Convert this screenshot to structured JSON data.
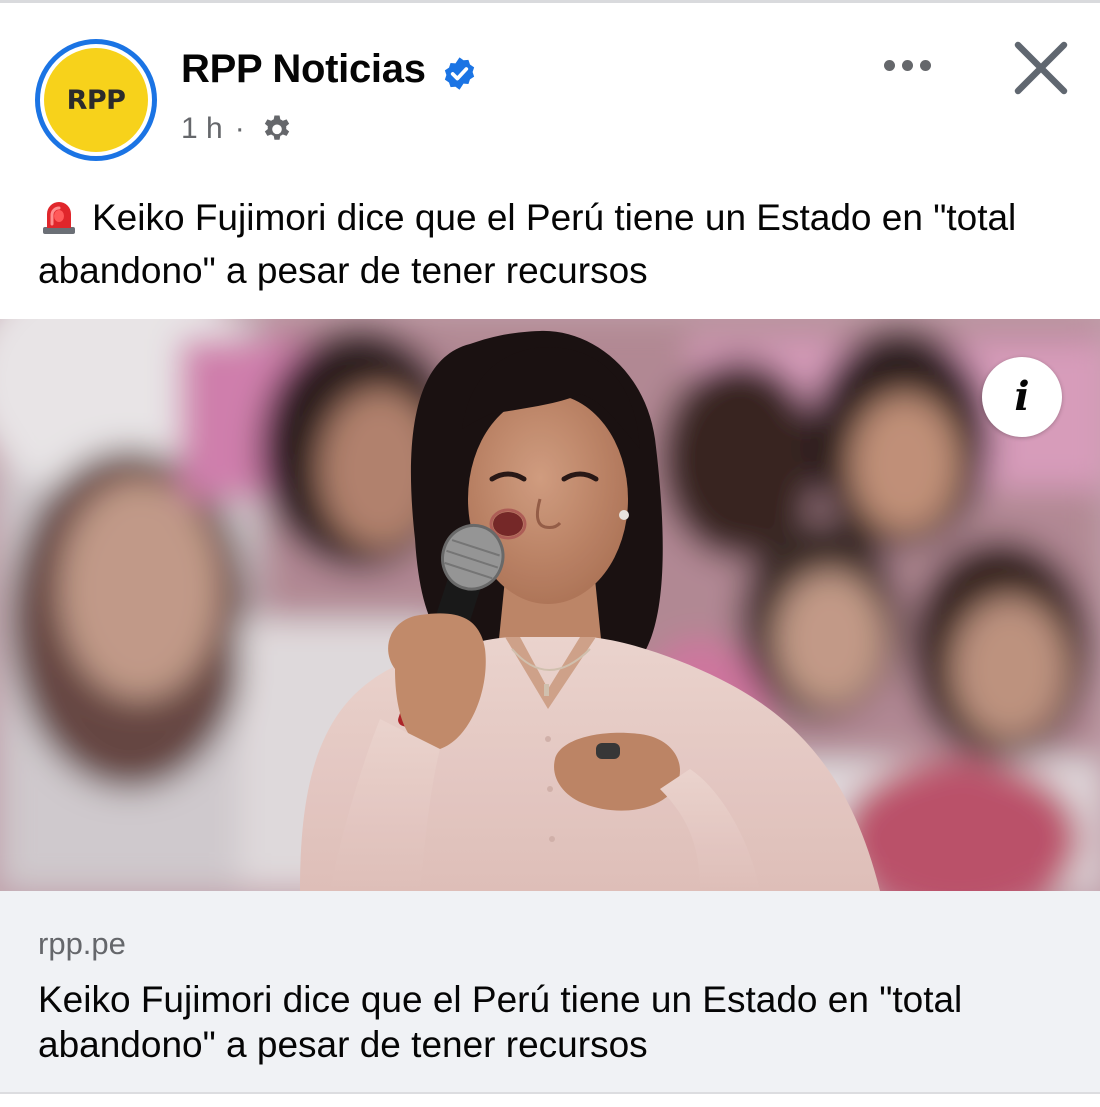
{
  "post": {
    "page_name": "RPP Noticias",
    "avatar_text": "RPP",
    "timestamp": "1 h",
    "meta_separator": "·",
    "audience_icon": "gear-icon",
    "more_icon": "more-horizontal-icon",
    "close_icon": "close-icon",
    "verified_icon": "verified-badge-icon",
    "caption_icon": "siren-icon",
    "caption": "Keiko Fujimori dice que el Perú tiene un Estado en \"total abandono\" a pesar de tener recursos",
    "photo_overlay_icon": "info-icon",
    "info_glyph": "i"
  },
  "link_preview": {
    "domain": "rpp.pe",
    "title": "Keiko Fujimori dice que el Perú tiene un Estado en \"total abandono\" a pesar de tener recursos"
  },
  "colors": {
    "brand_blue": "#1b74e4",
    "rpp_yellow": "#f7d21b",
    "secondary_text": "#65676b",
    "primary_text": "#050505",
    "preview_background": "#f0f2f5"
  }
}
